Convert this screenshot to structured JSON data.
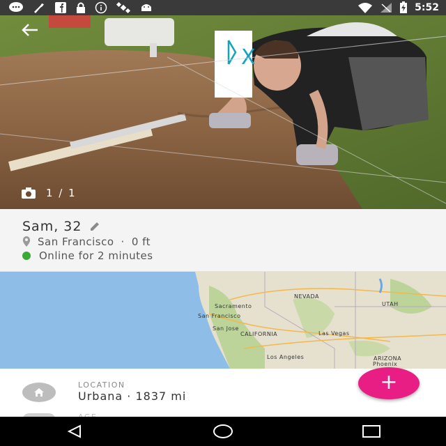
{
  "status_bar": {
    "time": "5:52",
    "left_icons": [
      "chat-bubble-icon",
      "wrench-icon",
      "facebook-icon",
      "lock-icon",
      "info-icon",
      "satellite-icon",
      "android-icon"
    ],
    "right_icons": [
      "wifi-icon",
      "signal-icon",
      "battery-charging-icon"
    ]
  },
  "photo": {
    "counter": "1 / 1",
    "sign_text": "DX"
  },
  "profile": {
    "name_age": "Sam, 32",
    "location": "San Francisco",
    "distance": "0 ft",
    "separator": "·",
    "online": "Online for 2 minutes"
  },
  "map": {
    "labels": {
      "sacramento": "Sacramento",
      "san_francisco": "San Francisco",
      "san_jose": "San Jose",
      "california": "CALIFORNIA",
      "nevada": "NEVADA",
      "utah": "UTAH",
      "las_vegas": "Las Vegas",
      "los_angeles": "Los Angeles",
      "arizona": "ARIZONA",
      "phoenix": "Phoenix"
    }
  },
  "details": {
    "location_label": "LOCATION",
    "location_value": "Urbana · 1837 mi",
    "next_label": "AGE"
  },
  "fab": {
    "label": "+"
  },
  "colors": {
    "accent": "#e91e84",
    "online": "#3aa935",
    "status_bar": "#3a3a3a"
  }
}
